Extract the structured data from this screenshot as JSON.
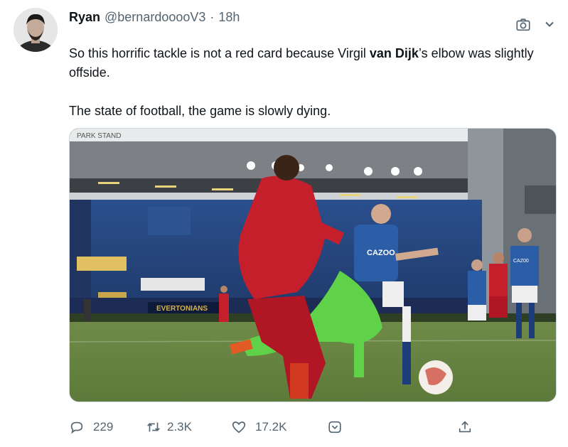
{
  "tweet": {
    "name": "Ryan",
    "handle": "@bernardooooV3",
    "separator": "·",
    "time": "18h",
    "text_line1_pre": "So this horrific tackle is not a red card because Virgil ",
    "text_line1_bold": "van Dijk",
    "text_line1_post": "’s elbow was slightly offside.",
    "text_line2": "The state of football, the game is slowly dying."
  },
  "media": {
    "stand_sign": "PARK STAND",
    "board_text": "EVERTONIANS",
    "shirt_sponsor": "CAZOO",
    "shirt_sponsor_small": "CAZ00"
  },
  "actions": {
    "replies": "229",
    "retweets": "2.3K",
    "likes": "17.2K"
  },
  "icons": [
    "camera-icon",
    "chevron-down-icon",
    "reply-icon",
    "retweet-icon",
    "like-icon",
    "bookmark-icon",
    "share-icon"
  ],
  "colors": {
    "text": "#0f1419",
    "muted": "#536471",
    "border": "#cfd9de"
  }
}
